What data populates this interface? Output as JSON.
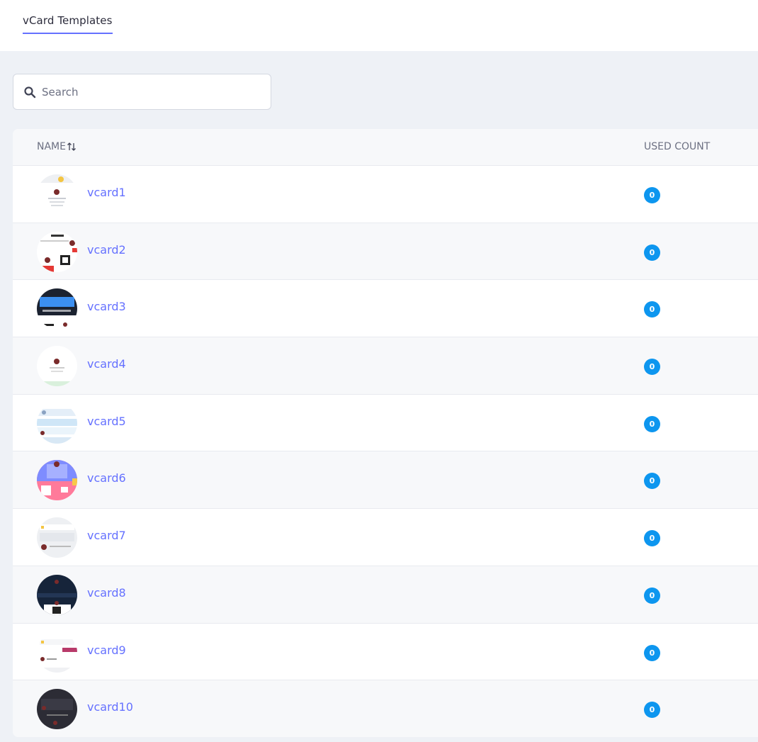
{
  "header": {
    "tab_label": "vCard Templates"
  },
  "search": {
    "placeholder": "Search",
    "value": ""
  },
  "table": {
    "columns": {
      "name": "NAME",
      "used_count": "USED COUNT"
    },
    "rows": [
      {
        "name": "vcard1",
        "used_count": "0"
      },
      {
        "name": "vcard2",
        "used_count": "0"
      },
      {
        "name": "vcard3",
        "used_count": "0"
      },
      {
        "name": "vcard4",
        "used_count": "0"
      },
      {
        "name": "vcard5",
        "used_count": "0"
      },
      {
        "name": "vcard6",
        "used_count": "0"
      },
      {
        "name": "vcard7",
        "used_count": "0"
      },
      {
        "name": "vcard8",
        "used_count": "0"
      },
      {
        "name": "vcard9",
        "used_count": "0"
      },
      {
        "name": "vcard10",
        "used_count": "0"
      }
    ]
  },
  "colors": {
    "accent": "#6571ff",
    "badge": "#0d96ef"
  },
  "icons": {
    "search": "search-icon",
    "sort": "sort-icon"
  }
}
